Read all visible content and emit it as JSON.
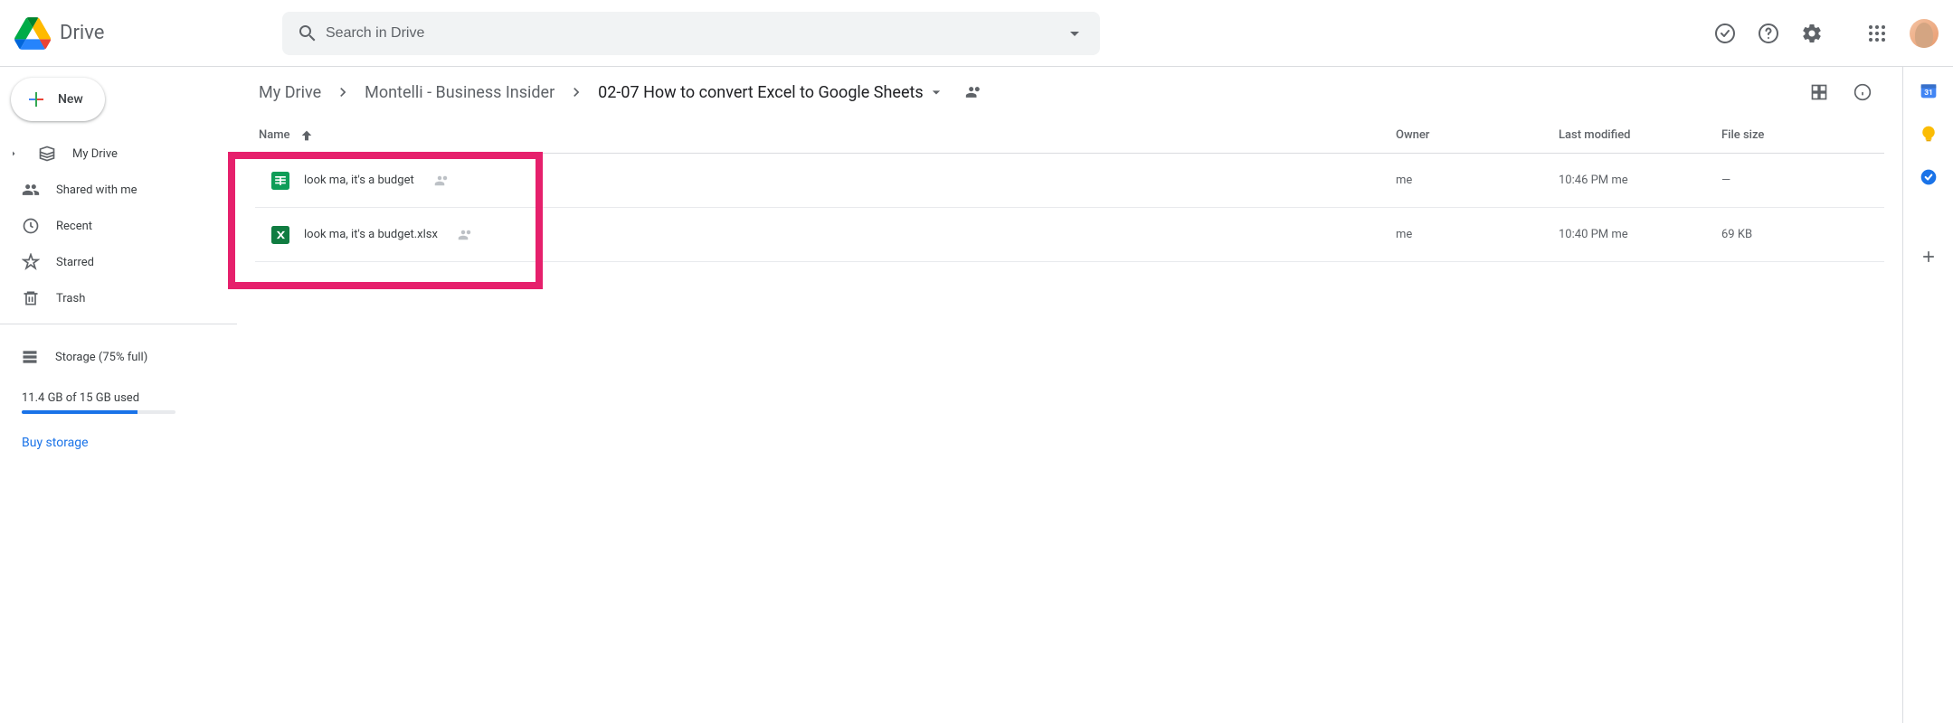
{
  "app": {
    "title": "Drive",
    "search_placeholder": "Search in Drive"
  },
  "sidebar": {
    "new_label": "New",
    "items": [
      {
        "label": "My Drive"
      },
      {
        "label": "Shared with me"
      },
      {
        "label": "Recent"
      },
      {
        "label": "Starred"
      },
      {
        "label": "Trash"
      }
    ],
    "storage": {
      "title": "Storage (75% full)",
      "used_text": "11.4 GB of 15 GB used",
      "percent": 75,
      "buy_label": "Buy storage"
    }
  },
  "breadcrumbs": [
    {
      "label": "My Drive"
    },
    {
      "label": "Montelli - Business Insider"
    },
    {
      "label": "02-07 How to convert Excel to Google Sheets"
    }
  ],
  "table": {
    "columns": {
      "name": "Name",
      "owner": "Owner",
      "modified": "Last modified",
      "size": "File size"
    },
    "rows": [
      {
        "type": "sheets",
        "name": "look ma, it's a budget",
        "shared": true,
        "owner": "me",
        "modified_time": "10:46 PM",
        "modified_by": "me",
        "size": "—"
      },
      {
        "type": "excel",
        "name": "look ma, it's a budget.xlsx",
        "shared": true,
        "owner": "me",
        "modified_time": "10:40 PM",
        "modified_by": "me",
        "size": "69 KB"
      }
    ]
  }
}
